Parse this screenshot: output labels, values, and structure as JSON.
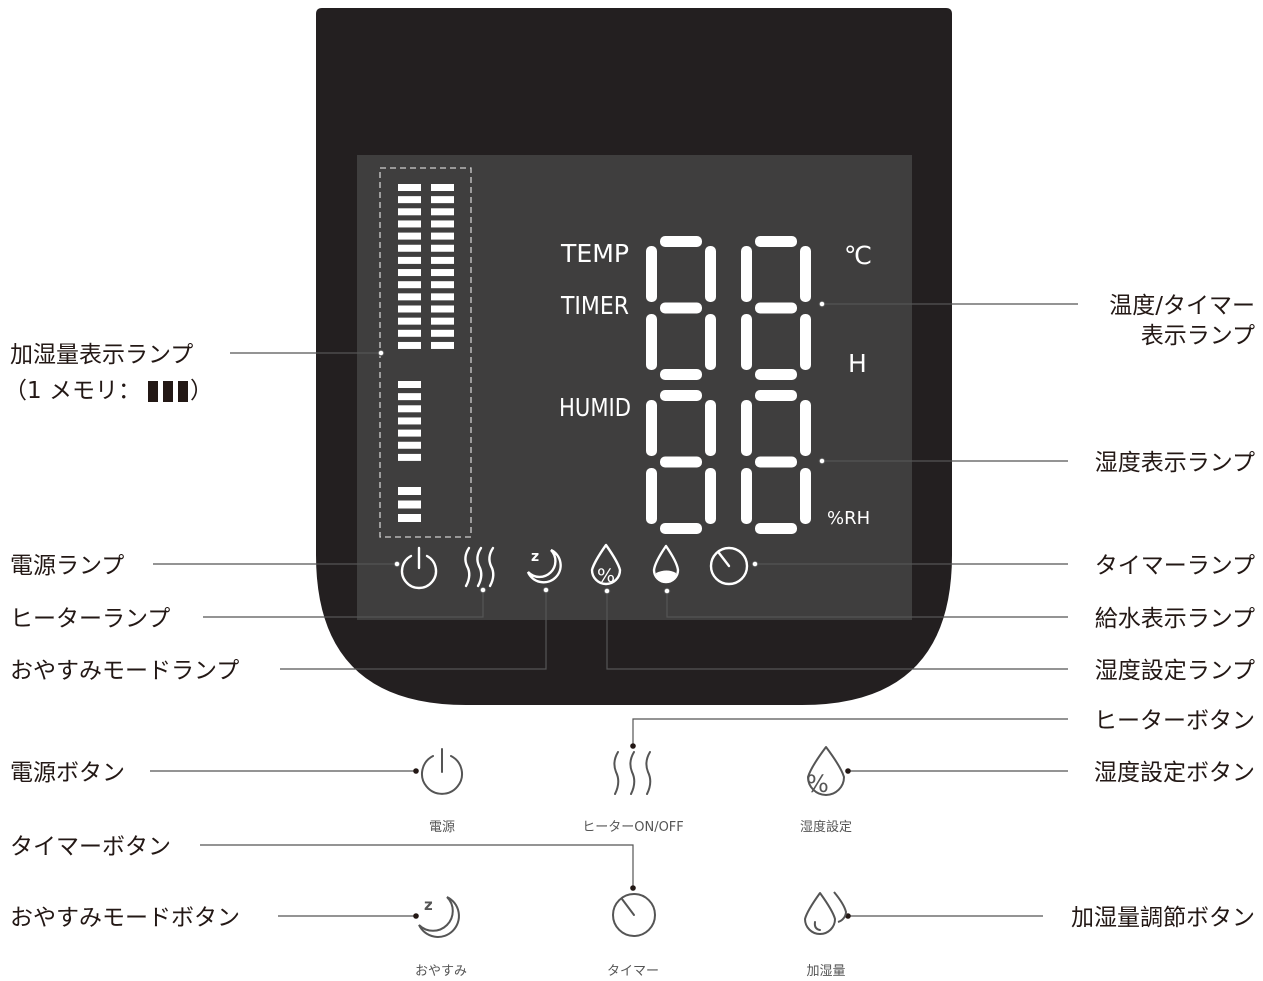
{
  "colors": {
    "device_body": "#231f20",
    "lcd_panel": "#3f3e3e",
    "lcd_segment": "#ffffff",
    "leader_line": "#555555",
    "button_icon": "#555555",
    "text": "#231815"
  },
  "lcd": {
    "temp_label": "TEMP",
    "timer_label": "TIMER",
    "celsius_unit": "℃",
    "hour_unit": "H",
    "humid_label": "HUMID",
    "rh_unit": "%RH",
    "upper_digits": "88",
    "lower_digits": "88"
  },
  "callouts_left": {
    "humidify_level_lamp": "加湿量表示ランプ",
    "humidify_level_note_open": "（1 メモリ：",
    "humidify_level_note_close": "）",
    "power_lamp": "電源ランプ",
    "heater_lamp": "ヒーターランプ",
    "sleep_mode_lamp": "おやすみモードランプ",
    "power_button": "電源ボタン",
    "timer_button": "タイマーボタン",
    "sleep_mode_button": "おやすみモードボタン"
  },
  "callouts_right": {
    "temp_timer_lamp_line1": "温度/タイマー",
    "temp_timer_lamp_line2": "表示ランプ",
    "humidity_display_lamp": "湿度表示ランプ",
    "timer_lamp": "タイマーランプ",
    "water_supply_lamp": "給水表示ランプ",
    "humidity_setting_lamp": "湿度設定ランプ",
    "heater_button": "ヒーターボタン",
    "humidity_setting_button": "湿度設定ボタン",
    "humidify_amount_button": "加湿量調節ボタン"
  },
  "buttons": {
    "power_caption": "電源",
    "heater_caption": "ヒーターON/OFF",
    "humidity_setting_caption": "湿度設定",
    "sleep_caption": "おやすみ",
    "timer_caption": "タイマー",
    "humidify_amount_caption": "加湿量"
  },
  "icons": {
    "power": "power-icon",
    "heater": "heater-waves-icon",
    "sleep": "sleep-moon-icon",
    "humidity_setting": "percent-droplet-icon",
    "water_supply": "water-droplet-icon",
    "timer": "timer-dial-icon",
    "humidify_amount": "double-droplet-icon"
  }
}
